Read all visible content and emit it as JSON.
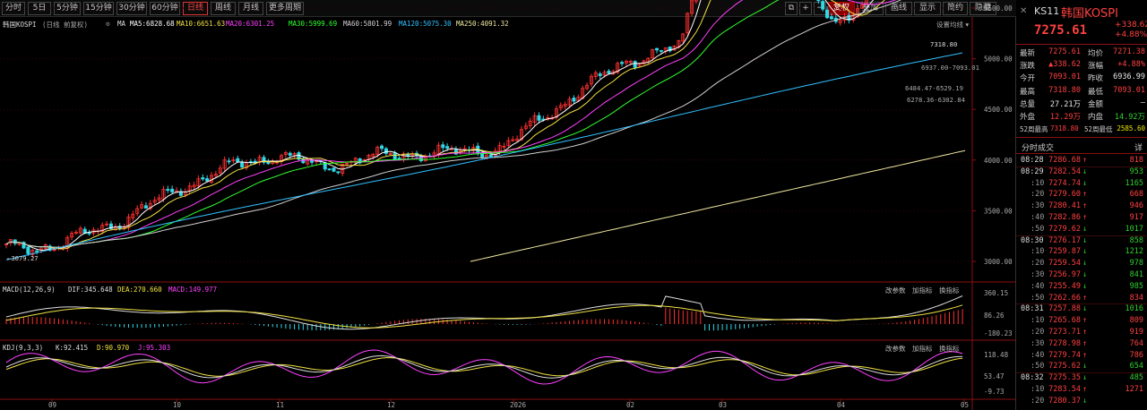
{
  "periods": [
    {
      "label": "分时",
      "active": false
    },
    {
      "label": "5日",
      "active": false
    },
    {
      "label": "5分钟",
      "active": false
    },
    {
      "label": "15分钟",
      "active": false
    },
    {
      "label": "30分钟",
      "active": false
    },
    {
      "label": "60分钟",
      "active": false
    },
    {
      "label": "日线",
      "active": true
    },
    {
      "label": "周线",
      "active": false
    },
    {
      "label": "月线",
      "active": false
    },
    {
      "label": "更多周期",
      "active": false
    }
  ],
  "toolbar": {
    "icon_window": "⧉",
    "plus": "+",
    "minus": "−",
    "reweight": "复权",
    "add": "叠加",
    "draw": "画线",
    "display": "显示",
    "simple": "简约",
    "hide": "隐藏"
  },
  "chart": {
    "title": "韩国KOSPI",
    "subtitle": "(日线 前复权)",
    "ma_prefix": "MA",
    "ma": [
      {
        "text": "MA5:6828.68",
        "color": "#ffffff"
      },
      {
        "text": "MA10:6651.63",
        "color": "#f0e040"
      },
      {
        "text": "MA20:6301.25",
        "color": "#ff40ff"
      },
      {
        "text": "MA30:5999.69",
        "color": "#30ff30"
      },
      {
        "text": "MA60:5801.99",
        "color": "#d0d0d0"
      },
      {
        "text": "MA120:5075.30",
        "color": "#30c0ff"
      },
      {
        "text": "MA250:4091.32",
        "color": "#f0e8a0"
      }
    ],
    "ma_settings": "设置均线",
    "y_labels": [
      "7000.00",
      "6500.00",
      "6000.00",
      "5500.00",
      "5000.00",
      "4500.00",
      "4000.00",
      "3500.00",
      "3000.00"
    ],
    "current_price_tag": "6584.60",
    "annotations": {
      "high": "7318.80",
      "range1": "6937.00-7093.01",
      "range2": "6484.47-6529.19",
      "range3": "6278.36-6302.84",
      "low": "3079.27"
    },
    "x_labels": [
      "09",
      "10",
      "11",
      "12",
      "2026",
      "02",
      "03",
      "04",
      "05"
    ]
  },
  "macd": {
    "title": "MACD(12,26,9)",
    "dif": "DIF:345.648",
    "dea": "DEA:270.660",
    "macd": "MACD:149.977",
    "y_labels": [
      "360.15",
      "86.26",
      "-180.23"
    ],
    "buttons": [
      "改参数",
      "加指标",
      "换指标"
    ]
  },
  "kdj": {
    "title": "KDJ(9,3,3)",
    "k": "K:92.415",
    "d": "D:90.970",
    "j": "J:95.303",
    "y_labels": [
      "118.48",
      "53.47",
      "-9.73"
    ],
    "buttons": [
      "改参数",
      "加指标",
      "换指标"
    ]
  },
  "quote": {
    "code": "KS11",
    "name": "韩国KOSPI",
    "price": "7275.61",
    "change": "+338.62",
    "pct": "+4.88%",
    "rows": [
      {
        "l1": "最新",
        "v1": "7275.61",
        "c1": "up",
        "l2": "均价",
        "v2": "7271.38",
        "c2": "up"
      },
      {
        "l1": "涨跌",
        "v1": "▲338.62",
        "c1": "up",
        "l2": "涨幅",
        "v2": "+4.88%",
        "c2": "up"
      },
      {
        "l1": "今开",
        "v1": "7093.01",
        "c1": "up",
        "l2": "昨收",
        "v2": "6936.99",
        "c2": "wh"
      },
      {
        "l1": "最高",
        "v1": "7318.80",
        "c1": "up",
        "l2": "最低",
        "v2": "7093.01",
        "c2": "up"
      },
      {
        "l1": "总量",
        "v1": "27.21万",
        "c1": "wh",
        "l2": "金额",
        "v2": "—",
        "c2": "wh"
      },
      {
        "l1": "外盘",
        "v1": "12.29万",
        "c1": "up",
        "l2": "内盘",
        "v2": "14.92万",
        "c2": "dn"
      }
    ],
    "w52": {
      "l1": "52周最高",
      "v1": "7318.80",
      "l2": "52周最低",
      "v2": "2585.60"
    }
  },
  "trades": {
    "title": "分时成交",
    "btn": "详",
    "rows": [
      {
        "t": "08:28",
        "p": "7286.68",
        "a": "↑",
        "v": "818",
        "vc": "up"
      },
      {
        "t": "08:29",
        "p": "7282.54",
        "a": "↓",
        "v": "953",
        "vc": "dn"
      },
      {
        "t": ":10",
        "p": "7274.74",
        "a": "↓",
        "v": "1165",
        "vc": "dn"
      },
      {
        "t": ":20",
        "p": "7279.60",
        "a": "↑",
        "v": "668",
        "vc": "up"
      },
      {
        "t": ":30",
        "p": "7280.41",
        "a": "↑",
        "v": "946",
        "vc": "up"
      },
      {
        "t": ":40",
        "p": "7282.86",
        "a": "↑",
        "v": "917",
        "vc": "up"
      },
      {
        "t": ":50",
        "p": "7279.62",
        "a": "↓",
        "v": "1017",
        "vc": "dn"
      },
      {
        "t": "08:30",
        "p": "7276.17",
        "a": "↓",
        "v": "858",
        "vc": "dn"
      },
      {
        "t": ":10",
        "p": "7259.87",
        "a": "↓",
        "v": "1212",
        "vc": "dn"
      },
      {
        "t": ":20",
        "p": "7259.54",
        "a": "↓",
        "v": "978",
        "vc": "dn"
      },
      {
        "t": ":30",
        "p": "7256.97",
        "a": "↓",
        "v": "841",
        "vc": "dn"
      },
      {
        "t": ":40",
        "p": "7255.49",
        "a": "↓",
        "v": "985",
        "vc": "dn"
      },
      {
        "t": ":50",
        "p": "7262.66",
        "a": "↑",
        "v": "834",
        "vc": "up"
      },
      {
        "t": "08:31",
        "p": "7257.88",
        "a": "↓",
        "v": "1016",
        "vc": "dn"
      },
      {
        "t": ":10",
        "p": "7265.68",
        "a": "↑",
        "v": "809",
        "vc": "up"
      },
      {
        "t": ":20",
        "p": "7273.71",
        "a": "↑",
        "v": "919",
        "vc": "up"
      },
      {
        "t": ":30",
        "p": "7278.98",
        "a": "↑",
        "v": "764",
        "vc": "up"
      },
      {
        "t": ":40",
        "p": "7279.74",
        "a": "↑",
        "v": "786",
        "vc": "up"
      },
      {
        "t": ":50",
        "p": "7275.62",
        "a": "↓",
        "v": "654",
        "vc": "dn"
      },
      {
        "t": "08:32",
        "p": "7275.35",
        "a": "↓",
        "v": "485",
        "vc": "dn"
      },
      {
        "t": ":10",
        "p": "7283.54",
        "a": "↑",
        "v": "1271",
        "vc": "up"
      },
      {
        "t": ":20",
        "p": "7280.37",
        "a": "↓",
        "v": "",
        "vc": "dn"
      }
    ]
  },
  "colors": {
    "up": "#ff4040",
    "down": "#30d0d0",
    "axis": "#8a1010",
    "grid": "#2a0000"
  }
}
